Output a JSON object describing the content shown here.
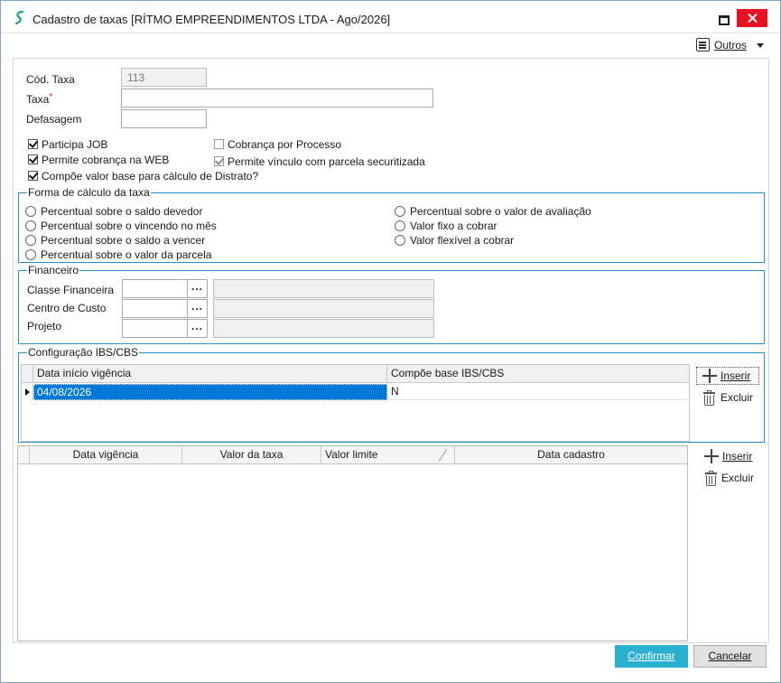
{
  "window": {
    "title": "Cadastro de taxas [RÍTMO EMPREENDIMENTOS LTDA - Ago/2026]"
  },
  "toolbar": {
    "outros_label": "Outros"
  },
  "form": {
    "cod_taxa_label": "Cód. Taxa",
    "cod_taxa_value": "113",
    "taxa_label": "Taxa",
    "taxa_required": "*",
    "taxa_value": "",
    "defasagem_label": "Defasagem",
    "defasagem_value": ""
  },
  "checkboxes": {
    "participa_job": {
      "label": "Participa JOB",
      "checked": true
    },
    "permite_cobranca_web": {
      "label": "Permite cobrança na WEB",
      "checked": true
    },
    "compoe_valor_base": {
      "label": "Compõe valor base para cálculo de Distrato?",
      "checked": true
    },
    "cobranca_por_processo": {
      "label": "Cobrança por Processo",
      "checked": false
    },
    "permite_vinculo": {
      "label": "Permite vínculo com parcela securitizada",
      "checked": true,
      "disabled": true
    }
  },
  "forma_calculo": {
    "title": "Forma de cálculo da taxa",
    "options_left": [
      "Percentual sobre o saldo devedor",
      "Percentual sobre o vincendo no mês",
      "Percentual sobre o saldo a vencer",
      "Percentual sobre o valor da parcela"
    ],
    "options_right": [
      "Percentual sobre o valor de avaliação",
      "Valor fixo a cobrar",
      "Valor flexível a cobrar"
    ]
  },
  "financeiro": {
    "title": "Financeiro",
    "classe_label": "Classe Financeira",
    "centro_label": "Centro de Custo",
    "projeto_label": "Projeto",
    "lookup_label": "..."
  },
  "ibs_cbs": {
    "title": "Configuração IBS/CBS",
    "columns": [
      "Data início vigência",
      "Compõe base IBS/CBS"
    ],
    "rows": [
      {
        "data_inicio": "04/08/2026",
        "compoe_base": "N"
      }
    ],
    "inserir_label": "Inserir",
    "excluir_label": "Excluir"
  },
  "vigencia": {
    "columns": [
      "Data vigência",
      "Valor da taxa",
      "Valor limite",
      "Data cadastro"
    ],
    "inserir_label": "Inserir",
    "excluir_label": "Excluir"
  },
  "footer": {
    "confirmar_label": "Confirmar",
    "cancelar_label": "Cancelar"
  },
  "colors": {
    "group_border": "#2b90c6",
    "selected_cell": "#0078d7",
    "primary_button": "#2aafd0",
    "close_button": "#e81123",
    "app_icon": "#1a9e7a"
  }
}
